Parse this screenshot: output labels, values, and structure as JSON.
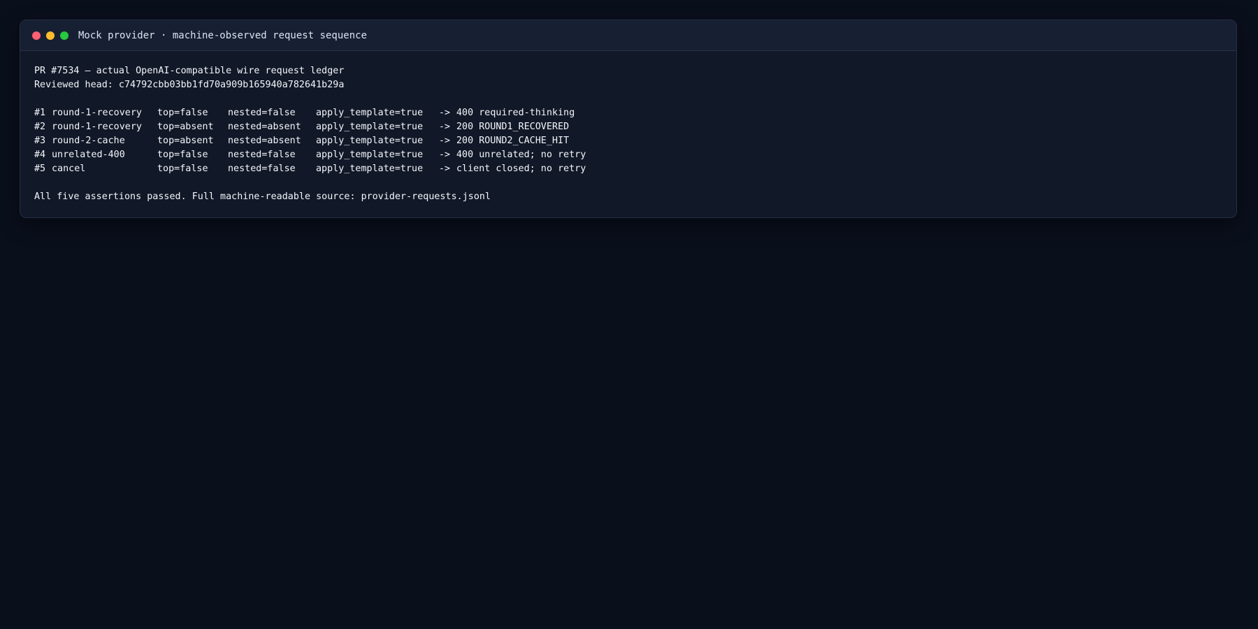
{
  "window": {
    "title": "Mock provider · machine-observed request sequence",
    "controls": {
      "close": "close",
      "minimize": "minimize",
      "zoom": "zoom"
    }
  },
  "ledger": {
    "heading": "PR #7534 — actual OpenAI-compatible wire request ledger",
    "head": "Reviewed head: c74792cbb03bb1fd70a909b165940a782641b29a",
    "rows": [
      {
        "id": "#1",
        "name": "round-1-recovery",
        "top": "top=false",
        "nested": "nested=false",
        "template": "apply_template=true",
        "arrow": "->",
        "result": "400 required-thinking"
      },
      {
        "id": "#2",
        "name": "round-1-recovery",
        "top": "top=absent",
        "nested": "nested=absent",
        "template": "apply_template=true",
        "arrow": "->",
        "result": "200 ROUND1_RECOVERED"
      },
      {
        "id": "#3",
        "name": "round-2-cache",
        "top": "top=absent",
        "nested": "nested=absent",
        "template": "apply_template=true",
        "arrow": "->",
        "result": "200 ROUND2_CACHE_HIT"
      },
      {
        "id": "#4",
        "name": "unrelated-400",
        "top": "top=false",
        "nested": "nested=false",
        "template": "apply_template=true",
        "arrow": "->",
        "result": "400 unrelated; no retry"
      },
      {
        "id": "#5",
        "name": "cancel",
        "top": "top=false",
        "nested": "nested=false",
        "template": "apply_template=true",
        "arrow": "->",
        "result": "client closed; no retry"
      }
    ],
    "summary": "All five assertions passed. Full machine-readable source: provider-requests.jsonl"
  },
  "colors": {
    "background": "#0a0f1c",
    "window": "#111827",
    "titlebar": "#172033",
    "close": "#ff5f71",
    "minimize": "#febc2e",
    "zoom": "#28c840"
  }
}
